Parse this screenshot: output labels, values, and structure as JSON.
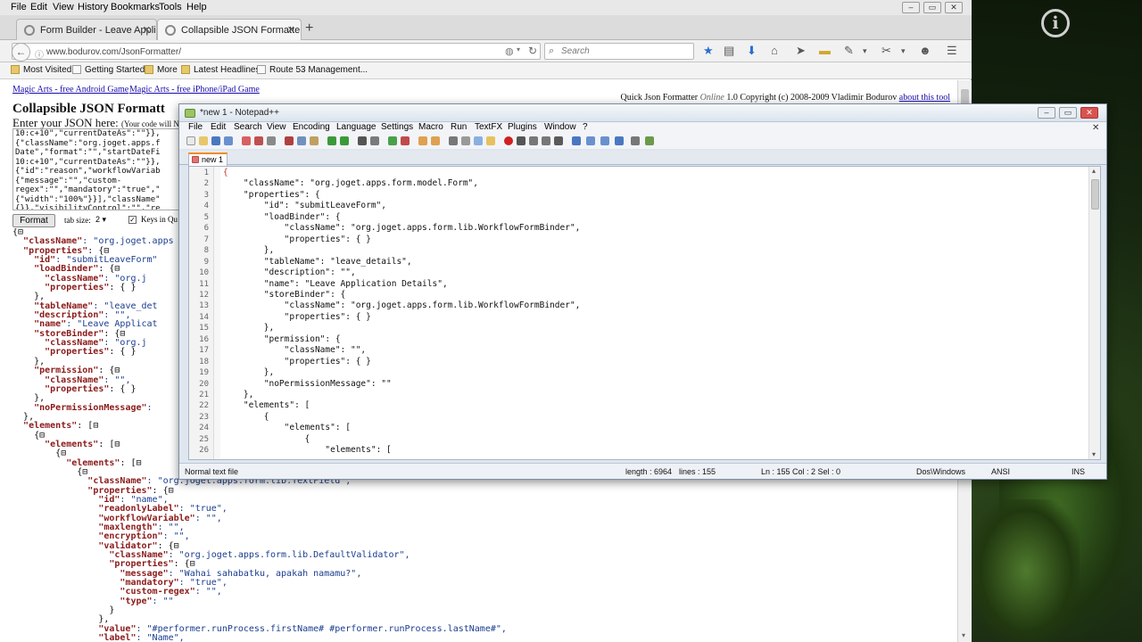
{
  "firefox": {
    "menu": [
      "File",
      "Edit",
      "View",
      "History",
      "Bookmarks",
      "Tools",
      "Help"
    ],
    "tabs": [
      {
        "label": "Form Builder - Leave Appli..."
      },
      {
        "label": "Collapsible JSON Formatter - vi..."
      }
    ],
    "url": "www.bodurov.com/JsonFormatter/",
    "search_placeholder": "Search",
    "bookmarks": [
      "Most Visited",
      "Getting Started",
      "More",
      "Latest Headlines",
      "Route 53 Management..."
    ]
  },
  "page": {
    "links": [
      "Magic Arts - free Android Game",
      "Magic Arts - free iPhone/iPad Game"
    ],
    "credit_prefix": "Quick Json Formatter",
    "credit_online": "Online",
    "credit_suffix": "1.0 Copyright (c) 2008-2009 Vladimir Bodurov",
    "about_link": "about this tool",
    "title": "Collapsible JSON Formatt",
    "enter_label": "Enter your JSON here:",
    "enter_hint": "(Your code will NO",
    "input_lines": [
      "10:c+10\",\"currentDateAs\":\"\"}},",
      "{\"className\":\"org.joget.apps.f",
      "Date\",\"format\":\"\",\"startDateFi",
      "10:c+10\",\"currentDateAs\":\"\"}},",
      "{\"id\":\"reason\",\"workflowVariab",
      "{\"message\":\"\",\"custom-",
      "regex\":\"\",\"mandatory\":\"true\",\"",
      "{\"width\":\"100%\"}}],\"className\"",
      "{}},\"visibilityControl\":\"\",\"re"
    ],
    "format_button": "Format",
    "tab_size_label": "tab size:",
    "tab_size_value": "2",
    "keys_label": "Keys in Qu",
    "tree": [
      {
        "i": 0,
        "k": "",
        "v": "",
        "b": "{⊟"
      },
      {
        "i": 2,
        "k": "\"className\"",
        "v": ": \"org.joget.apps",
        "b": ""
      },
      {
        "i": 2,
        "k": "\"properties\"",
        "v": "",
        "b": ": {⊟"
      },
      {
        "i": 4,
        "k": "\"id\"",
        "v": ": \"submitLeaveForm\"",
        "b": ""
      },
      {
        "i": 4,
        "k": "\"loadBinder\"",
        "v": "",
        "b": ": {⊟"
      },
      {
        "i": 6,
        "k": "\"className\"",
        "v": ": \"org.j",
        "b": ""
      },
      {
        "i": 6,
        "k": "\"properties\"",
        "v": "",
        "b": ": { }"
      },
      {
        "i": 4,
        "k": "",
        "v": "",
        "b": "},"
      },
      {
        "i": 4,
        "k": "\"tableName\"",
        "v": ": \"leave_det",
        "b": ""
      },
      {
        "i": 4,
        "k": "\"description\"",
        "v": ": \"\",",
        "b": ""
      },
      {
        "i": 4,
        "k": "\"name\"",
        "v": ": \"Leave Applicat",
        "b": ""
      },
      {
        "i": 4,
        "k": "\"storeBinder\"",
        "v": "",
        "b": ": {⊟"
      },
      {
        "i": 6,
        "k": "\"className\"",
        "v": ": \"org.j",
        "b": ""
      },
      {
        "i": 6,
        "k": "\"properties\"",
        "v": "",
        "b": ": { }"
      },
      {
        "i": 4,
        "k": "",
        "v": "",
        "b": "},"
      },
      {
        "i": 4,
        "k": "\"permission\"",
        "v": "",
        "b": ": {⊟"
      },
      {
        "i": 6,
        "k": "\"className\"",
        "v": ": \"\",",
        "b": ""
      },
      {
        "i": 6,
        "k": "\"properties\"",
        "v": "",
        "b": ": { }"
      },
      {
        "i": 4,
        "k": "",
        "v": "",
        "b": "},"
      },
      {
        "i": 4,
        "k": "\"noPermissionMessage\"",
        "v": ": ",
        "b": ""
      },
      {
        "i": 2,
        "k": "",
        "v": "",
        "b": "},"
      },
      {
        "i": 2,
        "k": "\"elements\"",
        "v": "",
        "b": ": [⊟"
      },
      {
        "i": 4,
        "k": "",
        "v": "",
        "b": "{⊟"
      },
      {
        "i": 6,
        "k": "\"elements\"",
        "v": "",
        "b": ": [⊟"
      },
      {
        "i": 8,
        "k": "",
        "v": "",
        "b": "{⊟"
      },
      {
        "i": 10,
        "k": "\"elements\"",
        "v": "",
        "b": ": [⊟"
      },
      {
        "i": 12,
        "k": "",
        "v": "",
        "b": "{⊟"
      },
      {
        "i": 14,
        "k": "\"className\"",
        "v": ": \"org.joget.apps.form.lib.TextField\",",
        "b": ""
      },
      {
        "i": 14,
        "k": "\"properties\"",
        "v": "",
        "b": ": {⊟"
      },
      {
        "i": 16,
        "k": "\"id\"",
        "v": ": \"name\",",
        "b": ""
      },
      {
        "i": 16,
        "k": "\"readonlyLabel\"",
        "v": ": \"true\",",
        "b": ""
      },
      {
        "i": 16,
        "k": "\"workflowVariable\"",
        "v": ": \"\",",
        "b": ""
      },
      {
        "i": 16,
        "k": "\"maxlength\"",
        "v": ": \"\",",
        "b": ""
      },
      {
        "i": 16,
        "k": "\"encryption\"",
        "v": ": \"\",",
        "b": ""
      },
      {
        "i": 16,
        "k": "\"validator\"",
        "v": "",
        "b": ": {⊟"
      },
      {
        "i": 18,
        "k": "\"className\"",
        "v": ": \"org.joget.apps.form.lib.DefaultValidator\",",
        "b": ""
      },
      {
        "i": 18,
        "k": "\"properties\"",
        "v": "",
        "b": ": {⊟"
      },
      {
        "i": 20,
        "k": "\"message\"",
        "v": ": \"Wahai sahabatku, apakah namamu?\",",
        "b": ""
      },
      {
        "i": 20,
        "k": "\"mandatory\"",
        "v": ": \"true\",",
        "b": ""
      },
      {
        "i": 20,
        "k": "\"custom-regex\"",
        "v": ": \"\",",
        "b": ""
      },
      {
        "i": 20,
        "k": "\"type\"",
        "v": ": \"\"",
        "b": ""
      },
      {
        "i": 18,
        "k": "",
        "v": "",
        "b": "}"
      },
      {
        "i": 16,
        "k": "",
        "v": "",
        "b": "},"
      },
      {
        "i": 16,
        "k": "\"value\"",
        "v": ": \"#performer.runProcess.firstName# #performer.runProcess.lastName#\",",
        "b": ""
      },
      {
        "i": 16,
        "k": "\"label\"",
        "v": ": \"Name\",",
        "b": ""
      }
    ]
  },
  "npp": {
    "title": "*new 1 - Notepad++",
    "menu": [
      "File",
      "Edit",
      "Search",
      "View",
      "Encoding",
      "Language",
      "Settings",
      "Macro",
      "Run",
      "TextFX",
      "Plugins",
      "Window",
      "?"
    ],
    "tab": "new 1",
    "lines": [
      "{",
      "    \"className\": \"org.joget.apps.form.model.Form\",",
      "    \"properties\": {",
      "        \"id\": \"submitLeaveForm\",",
      "        \"loadBinder\": {",
      "            \"className\": \"org.joget.apps.form.lib.WorkflowFormBinder\",",
      "            \"properties\": { }",
      "        },",
      "        \"tableName\": \"leave_details\",",
      "        \"description\": \"\",",
      "        \"name\": \"Leave Application Details\",",
      "        \"storeBinder\": {",
      "            \"className\": \"org.joget.apps.form.lib.WorkflowFormBinder\",",
      "            \"properties\": { }",
      "        },",
      "        \"permission\": {",
      "            \"className\": \"\",",
      "            \"properties\": { }",
      "        },",
      "        \"noPermissionMessage\": \"\"",
      "    },",
      "    \"elements\": [",
      "        {",
      "            \"elements\": [",
      "                {",
      "                    \"elements\": ["
    ],
    "status": {
      "type": "Normal text file",
      "length": "length : 6964",
      "lines": "lines : 155",
      "pos": "Ln : 155   Col : 2   Sel : 0",
      "eol": "Dos\\Windows",
      "enc": "ANSI",
      "mode": "INS"
    }
  }
}
